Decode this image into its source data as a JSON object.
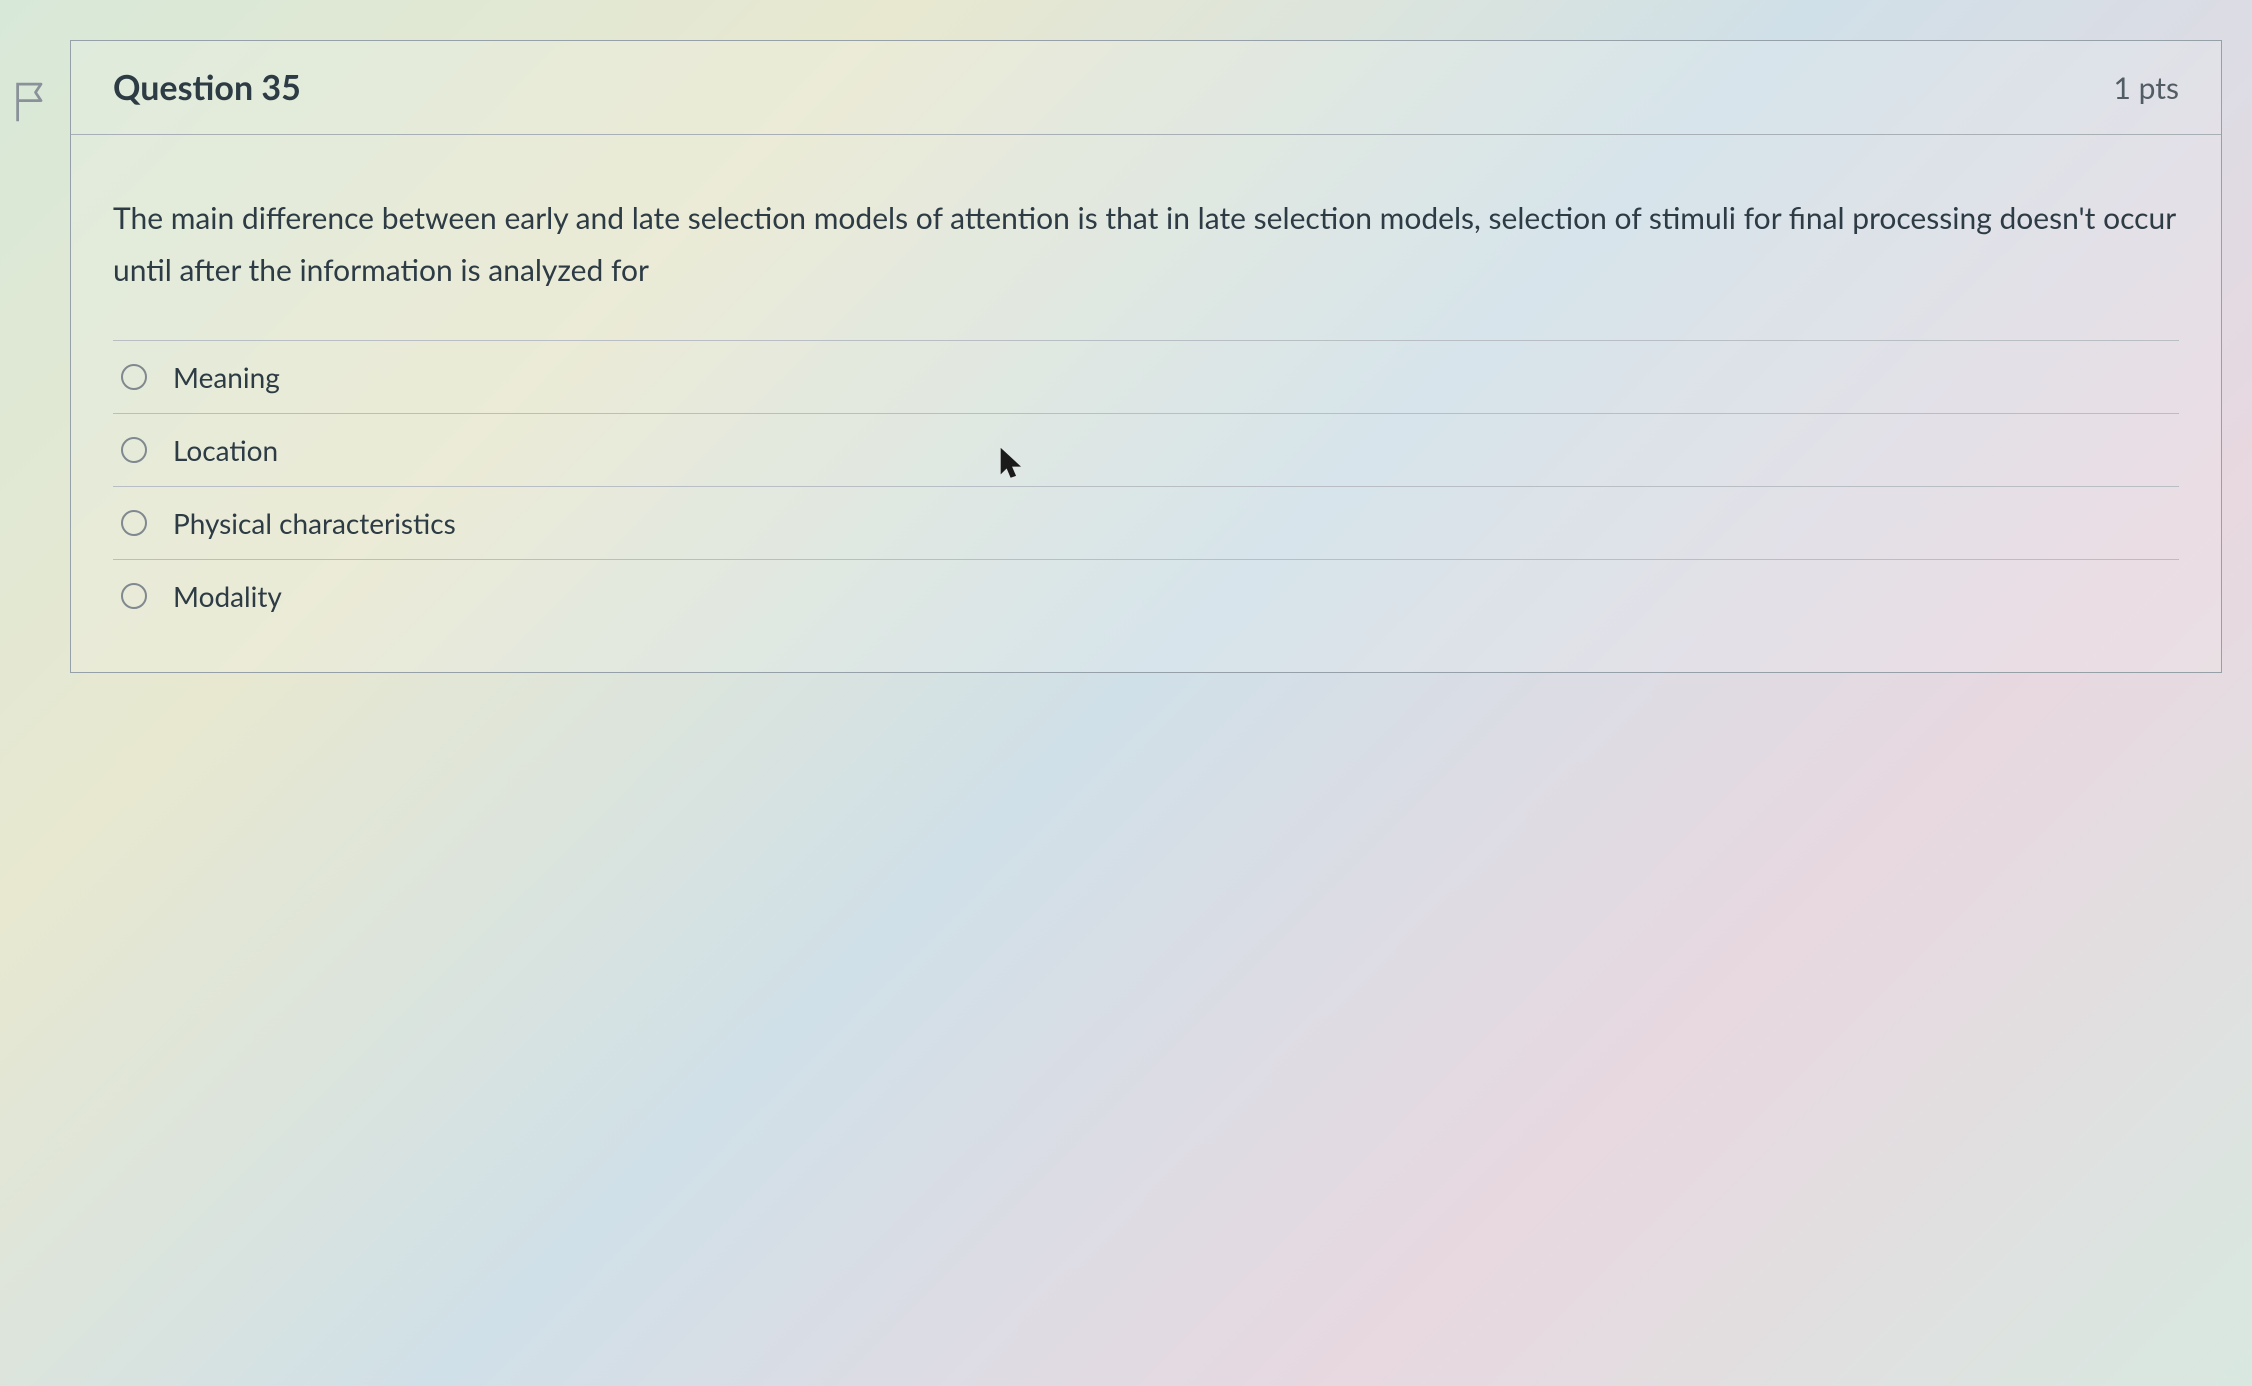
{
  "question": {
    "title": "Question 35",
    "points": "1 pts",
    "prompt": "The main difference between early and late selection models of attention is that in late selection models, selection of stimuli for final processing doesn't occur until after the information is analyzed for",
    "options": [
      {
        "label": "Meaning"
      },
      {
        "label": "Location"
      },
      {
        "label": "Physical characteristics"
      },
      {
        "label": "Modality"
      }
    ]
  }
}
